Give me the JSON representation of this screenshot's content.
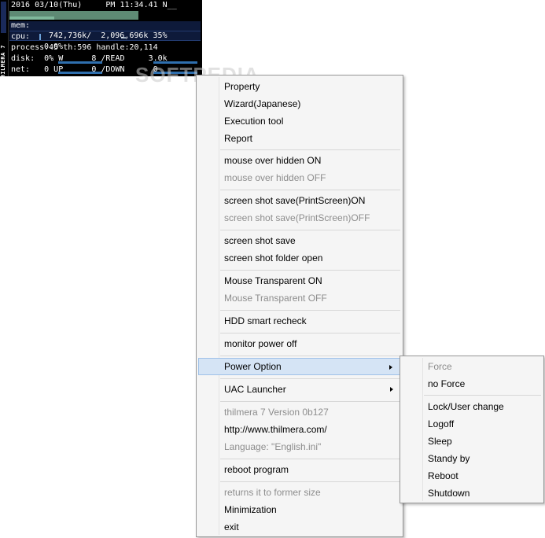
{
  "monitor": {
    "side_label": "THILMERA 7",
    "datetime": "2016 03/10(Thu)     PM 11:34.41 N__",
    "mem_label": "mem:",
    "mem_value": "742,736k/  2,096,696k 35%",
    "cpu_label": "cpu:",
    "cpu_value": "0.0%",
    "process_line": "process:45 th:596 handle:20,114",
    "disk_line": "disk:  0% W      8 /READ     3.0k",
    "net_line": "net:   0 UP      0 /DOWN      0",
    "mem_fraction": 0.35
  },
  "watermark": "SOFTPEDIA",
  "menu": {
    "items": [
      {
        "label": "Property",
        "enabled": true
      },
      {
        "label": "Wizard(Japanese)",
        "enabled": true
      },
      {
        "label": "Execution tool",
        "enabled": true
      },
      {
        "label": "Report",
        "enabled": true
      },
      {
        "label": "mouse over hidden ON",
        "enabled": true
      },
      {
        "label": "mouse over hidden OFF",
        "enabled": false
      },
      {
        "label": "screen shot save(PrintScreen)ON",
        "enabled": true
      },
      {
        "label": "screen shot save(PrintScreen)OFF",
        "enabled": false
      },
      {
        "label": "screen shot save",
        "enabled": true
      },
      {
        "label": "screen shot folder open",
        "enabled": true
      },
      {
        "label": "Mouse Transparent ON",
        "enabled": true
      },
      {
        "label": "Mouse Transparent OFF",
        "enabled": false
      },
      {
        "label": "HDD smart recheck",
        "enabled": true
      },
      {
        "label": "monitor power off",
        "enabled": true
      },
      {
        "label": "Power Option",
        "enabled": true,
        "submenu": true,
        "highlighted": true
      },
      {
        "label": "UAC Launcher",
        "enabled": true,
        "submenu": true
      },
      {
        "label": "thilmera 7 Version 0b127",
        "enabled": false
      },
      {
        "label": "http://www.thilmera.com/",
        "enabled": true
      },
      {
        "label": "Language: \"English.ini\"",
        "enabled": false
      },
      {
        "label": "reboot program",
        "enabled": true
      },
      {
        "label": "returns it to former size",
        "enabled": false
      },
      {
        "label": "Minimization",
        "enabled": true
      },
      {
        "label": "exit",
        "enabled": true
      }
    ]
  },
  "submenu": {
    "items": [
      {
        "label": "Force",
        "enabled": false
      },
      {
        "label": "no Force",
        "enabled": true
      },
      {
        "label": "Lock/User change",
        "enabled": true
      },
      {
        "label": "Logoff",
        "enabled": true
      },
      {
        "label": "Sleep",
        "enabled": true
      },
      {
        "label": "Standy by",
        "enabled": true
      },
      {
        "label": "Reboot",
        "enabled": true
      },
      {
        "label": "Shutdown",
        "enabled": true
      }
    ]
  }
}
